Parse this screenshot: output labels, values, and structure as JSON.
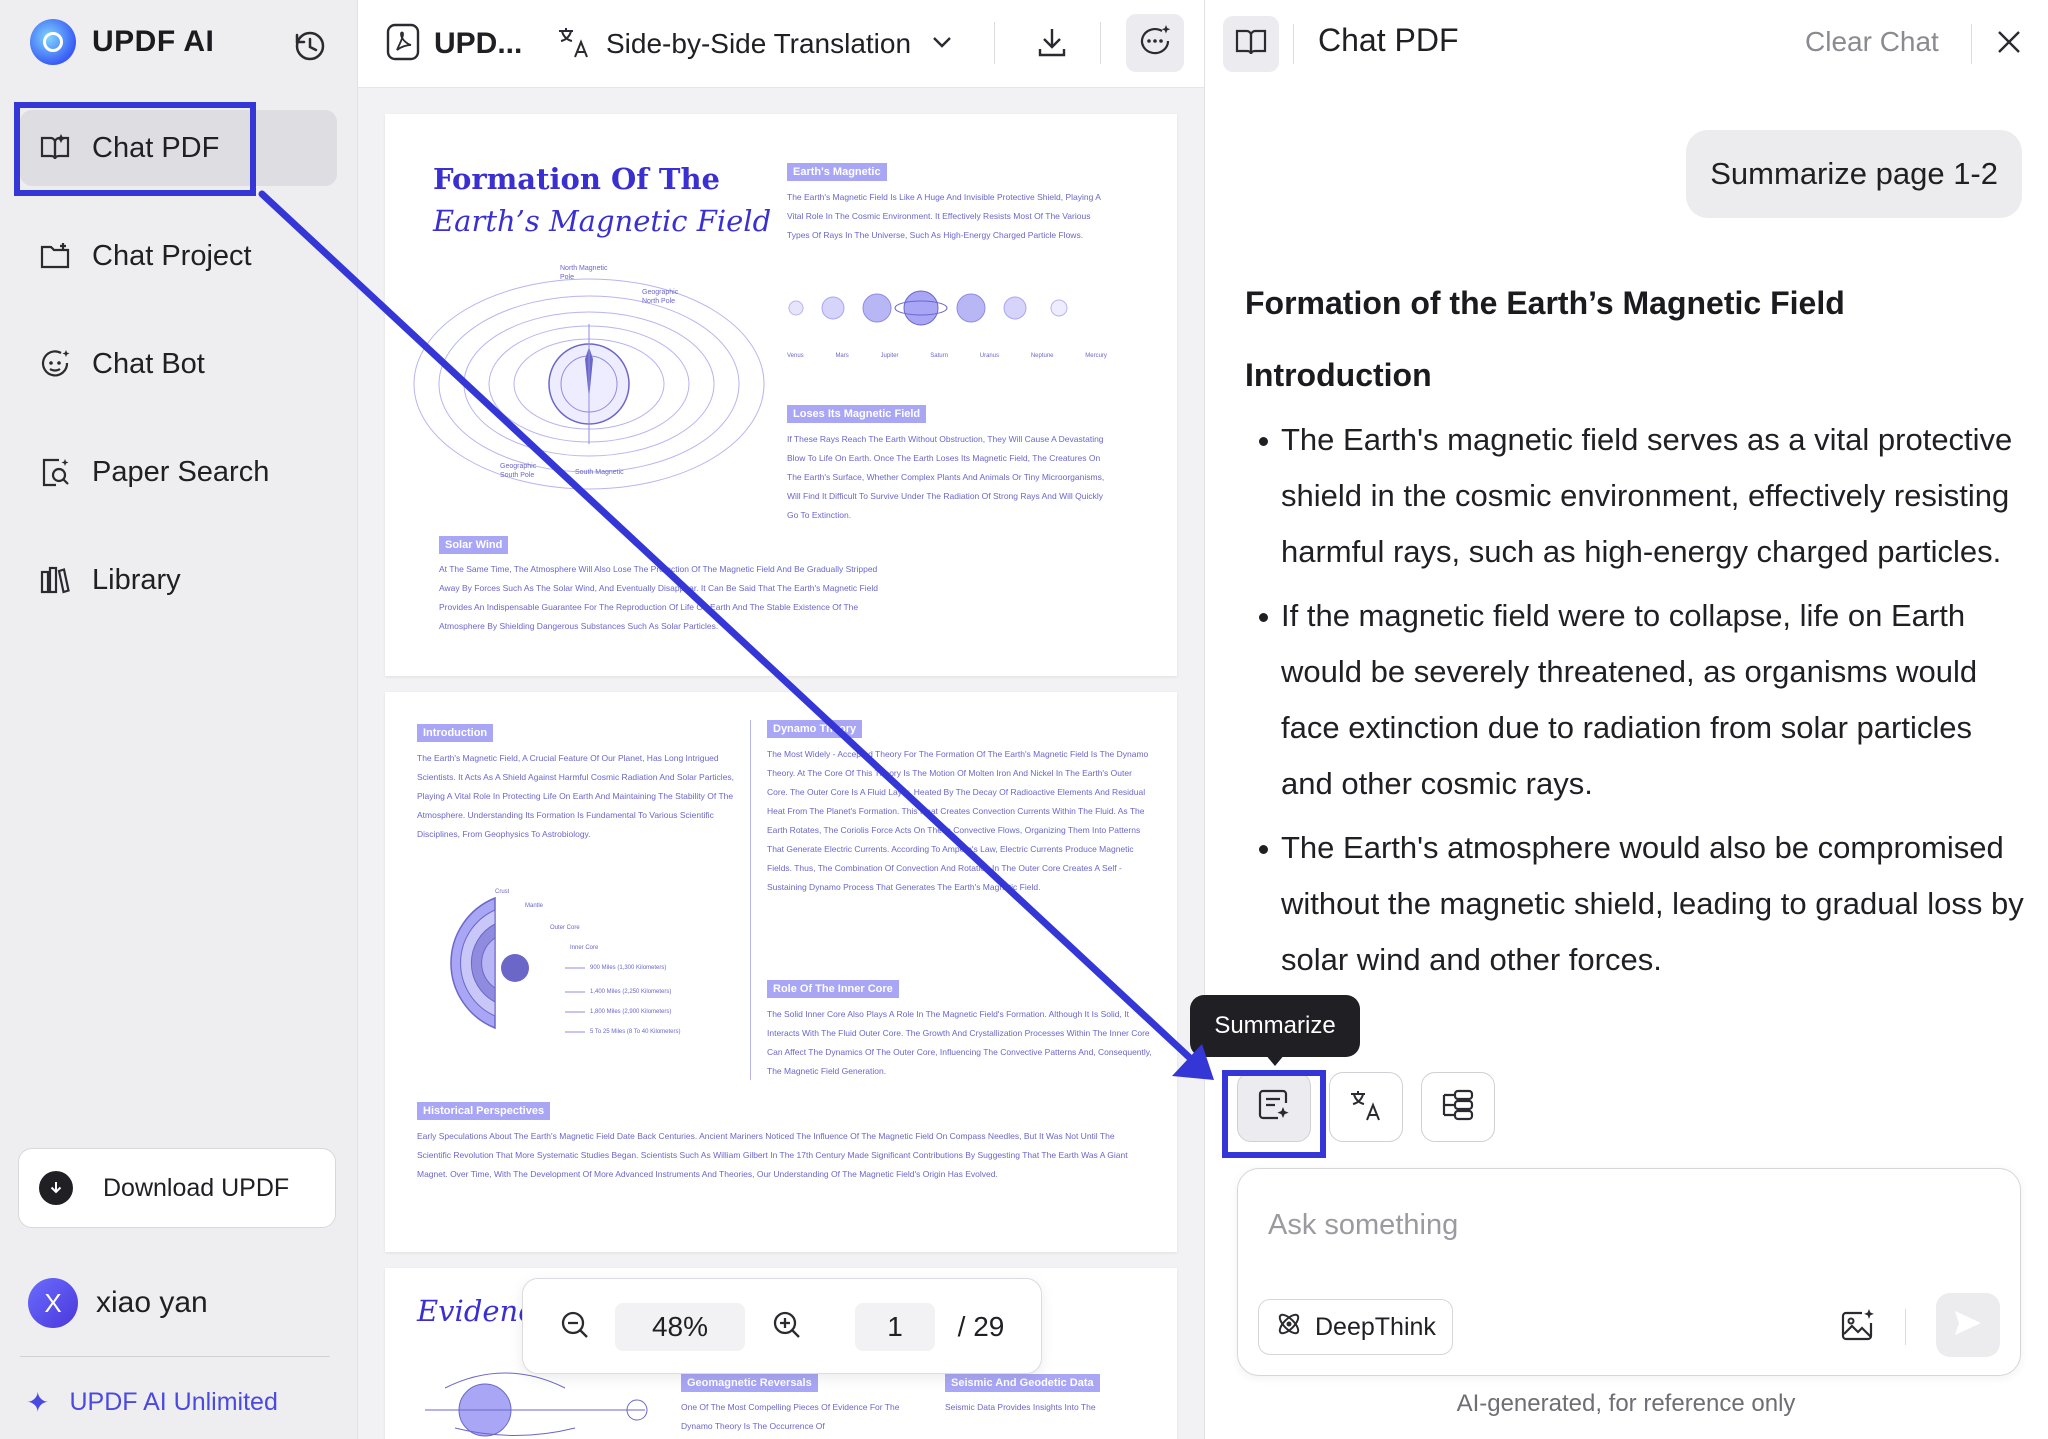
{
  "sidebar": {
    "brand": "UPDF AI",
    "nav": [
      {
        "label": "Chat PDF",
        "icon": "book-open-icon",
        "active": true
      },
      {
        "label": "Chat Project",
        "icon": "folder-plus-icon",
        "active": false
      },
      {
        "label": "Chat Bot",
        "icon": "bot-icon",
        "active": false
      },
      {
        "label": "Paper Search",
        "icon": "document-search-icon",
        "active": false
      },
      {
        "label": "Library",
        "icon": "library-icon",
        "active": false
      }
    ],
    "download_label": "Download UPDF",
    "user": {
      "initial": "X",
      "name": "xiao yan"
    },
    "unlimited_label": "UPDF AI Unlimited"
  },
  "viewer": {
    "doc_name": "UPD...",
    "translation_mode": "Side-by-Side Translation",
    "zoom": "48%",
    "page_current": "1",
    "page_total": "/ 29",
    "page1": {
      "title_line1": "Formation Of The",
      "title_line2": "Earth’s Magnetic Field",
      "tag_magnetic": "Earth's Magnetic",
      "text_magnetic": "The Earth's Magnetic Field Is Like A Huge And Invisible Protective Shield, Playing A Vital Role In The Cosmic Environment. It Effectively Resists Most Of The Various Types Of Rays In The Universe, Such As High-Energy Charged Particle Flows.",
      "planets": [
        "Venus",
        "Mars",
        "Jupiter",
        "Saturn",
        "Uranus",
        "Neptune",
        "Mercury"
      ],
      "tag_loses": "Loses Its Magnetic Field",
      "text_loses": "If These Rays Reach The Earth Without Obstruction, They Will Cause A Devastating Blow To Life On Earth. Once The Earth Loses Its Magnetic Field, The Creatures On The Earth's Surface, Whether Complex Plants And Animals Or Tiny Microorganisms, Will Find It Difficult To Survive Under The Radiation Of Strong Rays And Will Quickly Go To Extinction.",
      "tag_solar": "Solar Wind",
      "text_solar": "At The Same Time, The Atmosphere Will Also Lose The Protection Of The Magnetic Field And Be Gradually Stripped Away By Forces Such As The Solar Wind, And Eventually Disappear. It Can Be Said That The Earth's Magnetic Field Provides An Indispensable Guarantee For The Reproduction Of Life On Earth And The Stable Existence Of The Atmosphere By Shielding Dangerous Substances Such As Solar Particles.",
      "fig_labels": [
        "North Magnetic Pole",
        "Geographic North Pole",
        "Geographic South Pole",
        "South Magnetic"
      ]
    },
    "page2": {
      "tag_intro": "Introduction",
      "text_intro": "The Earth's Magnetic Field, A Crucial Feature Of Our Planet, Has Long Intrigued Scientists. It Acts As A Shield Against Harmful Cosmic Radiation And Solar Particles, Playing A Vital Role In Protecting Life On Earth And Maintaining The Stability Of The Atmosphere. Understanding Its Formation Is Fundamental To Various Scientific Disciplines, From Geophysics To Astrobiology.",
      "tag_dynamo": "Dynamo Theory",
      "text_dynamo": "The Most Widely - Accepted Theory For The Formation Of The Earth's Magnetic Field Is The Dynamo Theory. At The Core Of This Theory Is The Motion Of Molten Iron And Nickel In The Earth's Outer Core. The Outer Core Is A Fluid Layer, Heated By The Decay Of Radioactive Elements And Residual Heat From The Planet's Formation. This Heat Creates Convection Currents Within The Fluid. As The Earth Rotates, The Coriolis Force Acts On These Convective Flows, Organizing Them Into Patterns That Generate Electric Currents. According To Ampere's Law, Electric Currents Produce Magnetic Fields. Thus, The Combination Of Convection And Rotation In The Outer Core Creates A Self - Sustaining Dynamo Process That Generates The Earth's Magnetic Field.",
      "layers": [
        "Crust",
        "Mantle",
        "Outer Core",
        "Inner Core"
      ],
      "distances": [
        "900 Miles (1,300 Kilometers)",
        "1,400 Miles (2,250 Kilometers)",
        "1,800 Miles (2,900 Kilometers)",
        "5 To 25 Miles (8 To 40 Kilometers)"
      ],
      "tag_inner": "Role Of The Inner Core",
      "text_inner": "The Solid Inner Core Also Plays A Role In The Magnetic Field's Formation. Although It Is Solid, It Interacts With The Fluid Outer Core. The Growth And Crystallization Processes Within The Inner Core Can Affect The Dynamics Of The Outer Core, Influencing The Convective Patterns And, Consequently, The Magnetic Field Generation.",
      "tag_hist": "Historical Perspectives",
      "text_hist": "Early Speculations About The Earth's Magnetic Field Date Back Centuries. Ancient Mariners Noticed The Influence Of The Magnetic Field On Compass Needles, But It Was Not Until The Scientific Revolution That More Systematic Studies Began. Scientists Such As William Gilbert In The 17th Century Made Significant Contributions By Suggesting That The Earth Was A Giant Magnet. Over Time, With The Development Of More Advanced Instruments And Theories, Our Understanding Of The Magnetic Field's Origin Has Evolved."
    },
    "page3": {
      "title": "Evidence",
      "tag_geo": "Geomagnetic Reversals",
      "text_geo": "One Of The Most Compelling Pieces Of Evidence For The Dynamo Theory Is The Occurrence Of",
      "tag_seis": "Seismic And Geodetic Data",
      "text_seis": "Seismic Data Provides Insights Into The"
    }
  },
  "chat": {
    "title": "Chat PDF",
    "clear_label": "Clear Chat",
    "user_message": "Summarize page 1-2",
    "answer": {
      "heading": "Formation of the Earth’s Magnetic Field",
      "subheading": "Introduction",
      "bullets": [
        "The Earth's magnetic field serves as a vital protective shield in the cosmic environment, effectively resisting harmful rays, such as high-energy charged particles.",
        "If the magnetic field were to collapse, life on Earth would be severely threatened, as organisms would face extinction due to radiation from solar particles and other cosmic rays.",
        "The Earth's atmosphere would also be compromised without the magnetic shield, leading to gradual loss by solar wind and other forces."
      ]
    },
    "tooltip": "Summarize",
    "quick_actions": [
      {
        "name": "summarize-icon"
      },
      {
        "name": "translate-icon"
      },
      {
        "name": "mindmap-icon"
      }
    ],
    "input_placeholder": "Ask something",
    "deepthink_label": "DeepThink",
    "disclaimer": "AI-generated, for reference only"
  },
  "colors": {
    "annotation_blue": "#3437d6",
    "doc_accent": "#3a2fd0",
    "doc_tag": "#a9a6f5"
  }
}
